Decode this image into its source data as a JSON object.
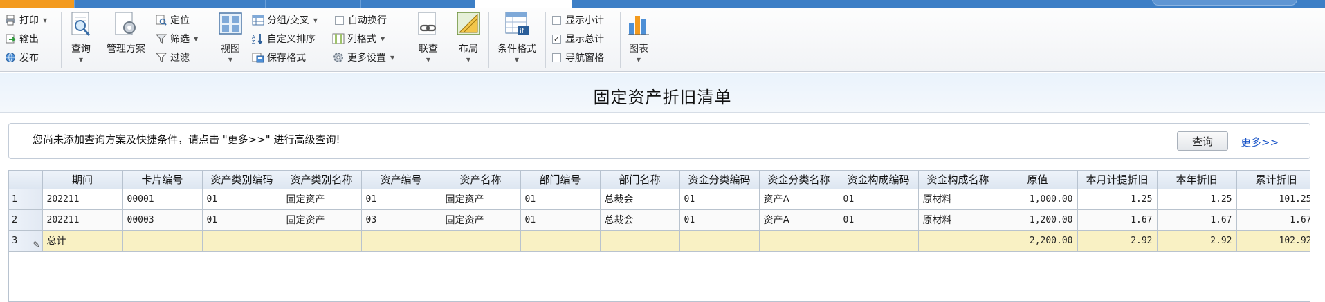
{
  "ribbon": {
    "print": "打印",
    "export": "输出",
    "publish": "发布",
    "query": "查询",
    "manage_scheme": "管理方案",
    "locate": "定位",
    "filter": "筛选",
    "filter2": "过滤",
    "view": "视图",
    "group_cross": "分组/交叉",
    "custom_sort": "自定义排序",
    "save_format": "保存格式",
    "auto_wrap": "自动换行",
    "column_format": "列格式",
    "more_settings": "更多设置",
    "link_query": "联查",
    "layout": "布局",
    "conditional_format": "条件格式",
    "show_subtotal": "显示小计",
    "show_total": "显示总计",
    "nav_pane": "导航窗格",
    "chart": "图表",
    "show_total_checked": true
  },
  "page": {
    "title": "固定资产折旧清单"
  },
  "query_panel": {
    "message": "您尚未添加查询方案及快捷条件，请点击 \"更多>>\" 进行高级查询!",
    "query_button": "查询",
    "more_link": "更多>>"
  },
  "grid": {
    "columns": [
      "期间",
      "卡片编号",
      "资产类别编码",
      "资产类别名称",
      "资产编号",
      "资产名称",
      "部门编号",
      "部门名称",
      "资金分类编码",
      "资金分类名称",
      "资金构成编码",
      "资金构成名称",
      "原值",
      "本月计提折旧",
      "本年折旧",
      "累计折旧"
    ],
    "rows": [
      {
        "no": "1",
        "cells": [
          "202211",
          "00001",
          "01",
          "固定资产",
          "01",
          "固定资产",
          "01",
          "总裁会",
          "01",
          "资产A",
          "01",
          "原材料",
          "1,000.00",
          "1.25",
          "1.25",
          "101.25"
        ]
      },
      {
        "no": "2",
        "cells": [
          "202211",
          "00003",
          "01",
          "固定资产",
          "03",
          "固定资产",
          "01",
          "总裁会",
          "01",
          "资产A",
          "01",
          "原材料",
          "1,200.00",
          "1.67",
          "1.67",
          "1.67"
        ]
      }
    ],
    "total": {
      "no": "3",
      "label": "总计",
      "values": [
        "2,200.00",
        "2.92",
        "2.92",
        "102.92"
      ]
    }
  },
  "colors": {
    "accent": "#3d7fc6",
    "tab_orange": "#f39a1e",
    "total_row": "#f9f1c4",
    "link": "#1a55c8"
  }
}
